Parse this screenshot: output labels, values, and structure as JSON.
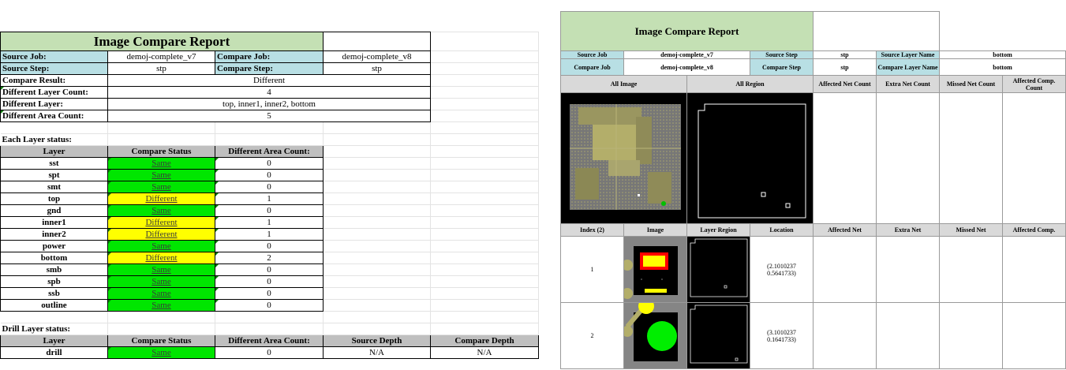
{
  "left": {
    "title": "Image Compare Report",
    "source_job_label": "Source Job:",
    "source_job": "demoj-complete_v7",
    "compare_job_label": "Compare Job:",
    "compare_job": "demoj-complete_v8",
    "source_step_label": "Source Step:",
    "source_step": "stp",
    "compare_step_label": "Compare Step:",
    "compare_step": "stp",
    "compare_result_label": "Compare Result:",
    "compare_result": "Different",
    "diff_layer_count_label": "Different Layer Count:",
    "diff_layer_count": "4",
    "diff_layer_label": "Different Layer:",
    "diff_layer": "top, inner1, inner2, bottom",
    "diff_area_count_label": "Different Area Count:",
    "diff_area_count": "5",
    "each_layer_status": "Each Layer status:",
    "layer_headers": [
      "Layer",
      "Compare Status",
      "Different Area Count:"
    ],
    "layers": [
      {
        "name": "sst",
        "status": "Same",
        "count": "0"
      },
      {
        "name": "spt",
        "status": "Same",
        "count": "0"
      },
      {
        "name": "smt",
        "status": "Same",
        "count": "0"
      },
      {
        "name": "top",
        "status": "Different",
        "count": "1"
      },
      {
        "name": "gnd",
        "status": "Same",
        "count": "0"
      },
      {
        "name": "inner1",
        "status": "Different",
        "count": "1"
      },
      {
        "name": "inner2",
        "status": "Different",
        "count": "1"
      },
      {
        "name": "power",
        "status": "Same",
        "count": "0"
      },
      {
        "name": "bottom",
        "status": "Different",
        "count": "2"
      },
      {
        "name": "smb",
        "status": "Same",
        "count": "0"
      },
      {
        "name": "spb",
        "status": "Same",
        "count": "0"
      },
      {
        "name": "ssb",
        "status": "Same",
        "count": "0"
      },
      {
        "name": "outline",
        "status": "Same",
        "count": "0"
      }
    ],
    "drill_layer_status": "Drill Layer status:",
    "drill_headers": [
      "Layer",
      "Compare Status",
      "Different Area Count:",
      "Source Depth",
      "Compare Depth"
    ],
    "drill": {
      "name": "drill",
      "status": "Same",
      "count": "0",
      "source_depth": "N/A",
      "compare_depth": "N/A"
    }
  },
  "right": {
    "title": "Image Compare Report",
    "source_job_label": "Source Job",
    "source_job": "demoj-complete_v7",
    "source_step_label": "Source Step",
    "source_step": "stp",
    "source_layer_name_label": "Source Layer Name",
    "source_layer_name": "bottom",
    "compare_job_label": "Compare Job",
    "compare_job": "demoj-complete_v8",
    "compare_step_label": "Compare Step",
    "compare_step": "stp",
    "compare_layer_name_label": "Compare Layer Name",
    "compare_layer_name": "bottom",
    "summary_headers": [
      "All Image",
      "All Region",
      "Affected Net Count",
      "Extra Net Count",
      "Missed Net Count",
      "Affected Comp. Count"
    ],
    "detail_headers": [
      "Index (2)",
      "Image",
      "Layer Region",
      "Location",
      "Affected Net",
      "Extra Net",
      "Missed Net",
      "Affected Comp."
    ],
    "rows": [
      {
        "index": "1",
        "loc1": "(2.1010237",
        "loc2": "0.5641733)"
      },
      {
        "index": "2",
        "loc1": "(3.1010237",
        "loc2": "0.1641733)"
      }
    ]
  },
  "colors": {
    "same": "#00e600",
    "different": "#ffff00",
    "title": "#c4e0b4",
    "label": "#b8dfe4",
    "header": "#bfbfbf"
  }
}
